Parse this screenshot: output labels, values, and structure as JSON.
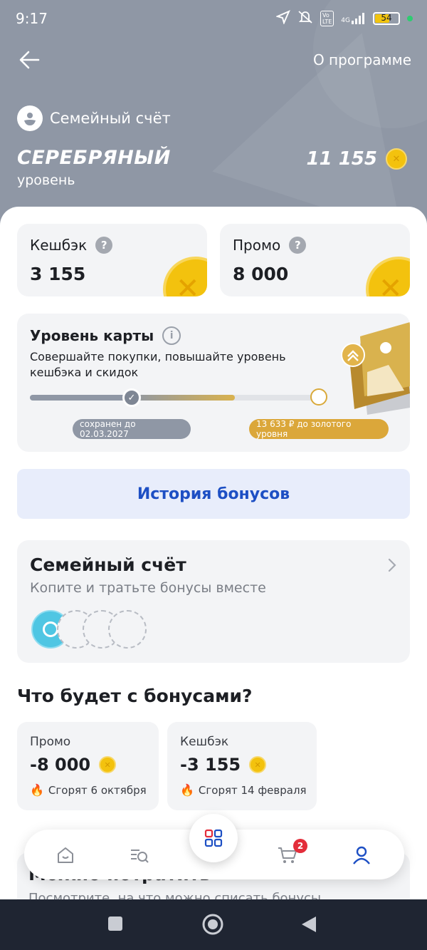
{
  "status": {
    "time": "9:17",
    "network": "4G",
    "battery": "54"
  },
  "header": {
    "about_label": "О программе",
    "account_label": "Семейный счёт",
    "level_name": "СЕРЕБРЯНЫЙ",
    "level_sub": "уровень",
    "total_points": "11 155"
  },
  "balances": [
    {
      "title": "Кешбэк",
      "value": "3 155"
    },
    {
      "title": "Промо",
      "value": "8 000"
    }
  ],
  "card_level": {
    "title": "Уровень карты",
    "description": "Совершайте покупки, повышайте уровень кешбэка и скидок",
    "saved_until": "сохранен до 02.03.2027",
    "to_gold": "13 633 ₽ до золотого уровня",
    "progress": 0.71
  },
  "history_button": "История бонусов",
  "family": {
    "title": "Семейный счёт",
    "subtitle": "Копите и тратьте бонусы вместе"
  },
  "expiry": {
    "heading": "Что будет с бонусами?",
    "items": [
      {
        "title": "Промо",
        "value": "-8 000",
        "note": "Сгорят 6 октября"
      },
      {
        "title": "Кешбэк",
        "value": "-3 155",
        "note": "Сгорят 14 февраля"
      }
    ]
  },
  "spend": {
    "title": "Можно потратить",
    "subtitle": "Посмотрите, на что можно списать бонусы"
  },
  "tabbar": {
    "cart_badge": "2"
  },
  "colors": {
    "accent": "#1d4fc4",
    "header": "#8f97a5",
    "gold": "#f3c20e",
    "badge": "#e32d3a"
  }
}
